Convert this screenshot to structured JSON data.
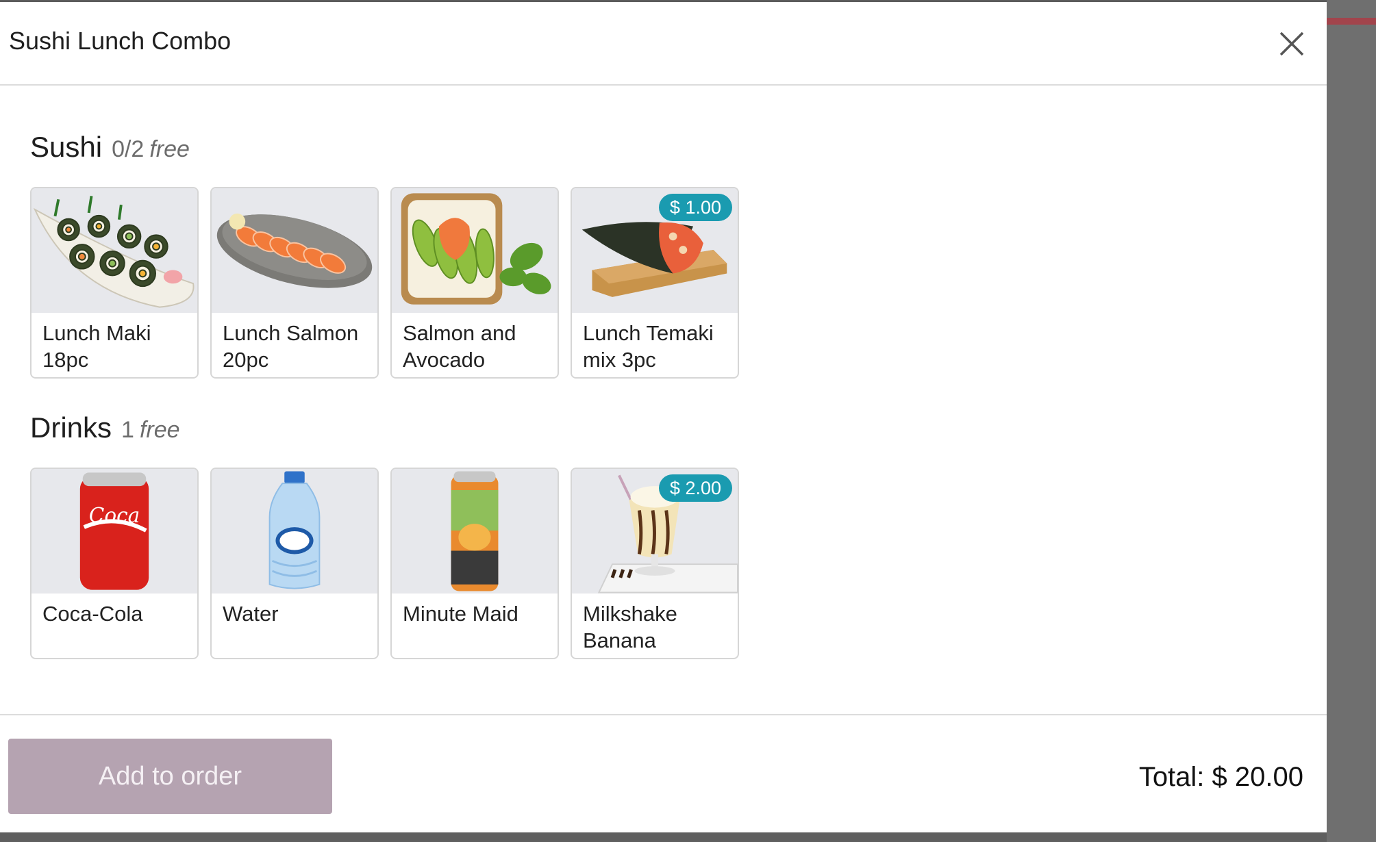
{
  "modal": {
    "title": "Sushi Lunch Combo"
  },
  "sections": [
    {
      "title": "Sushi",
      "count": "0/2",
      "free": "free",
      "items": [
        {
          "name": "Lunch Maki 18pc",
          "price": "",
          "icon": "maki-rolls-image"
        },
        {
          "name": "Lunch Salmon 20pc",
          "price": "",
          "icon": "salmon-sashimi-image"
        },
        {
          "name": "Salmon and Avocado",
          "price": "",
          "icon": "salmon-avocado-toast-image"
        },
        {
          "name": "Lunch Temaki mix 3pc",
          "price": "$ 1.00",
          "icon": "temaki-image"
        }
      ]
    },
    {
      "title": "Drinks",
      "count": "1",
      "free": "free",
      "items": [
        {
          "name": "Coca-Cola",
          "price": "",
          "icon": "coca-cola-can-image"
        },
        {
          "name": "Water",
          "price": "",
          "icon": "water-bottle-image"
        },
        {
          "name": "Minute Maid",
          "price": "",
          "icon": "minute-maid-can-image"
        },
        {
          "name": "Milkshake Banana",
          "price": "$ 2.00",
          "icon": "milkshake-image"
        }
      ]
    }
  ],
  "footer": {
    "add_label": "Add to order",
    "total_label": "Total: $ 20.00"
  },
  "colors": {
    "price_badge": "#1a9bb0",
    "add_button": "#b5a3b1",
    "image_bg": "#e7e8ec"
  }
}
